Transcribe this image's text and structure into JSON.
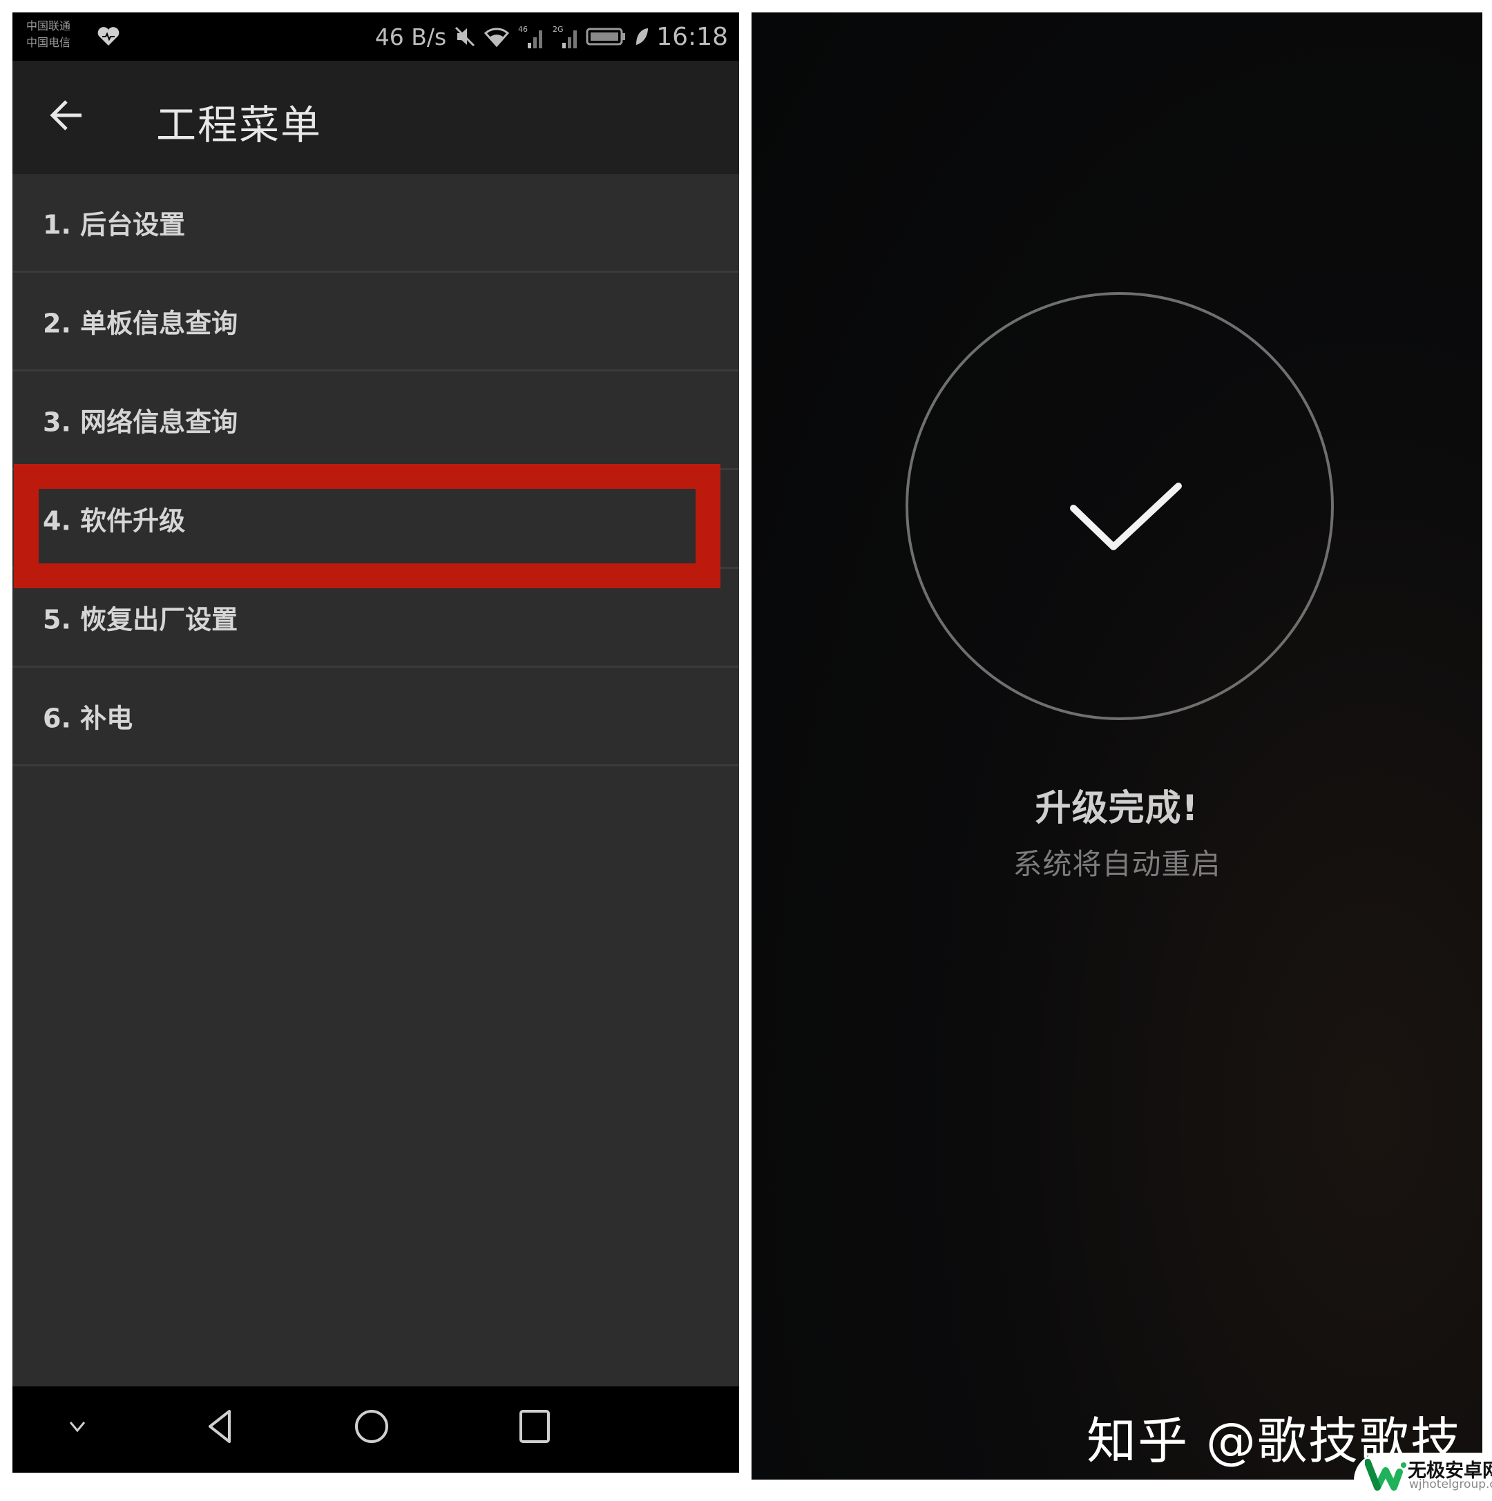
{
  "left_screen": {
    "status_bar": {
      "carriers": [
        "中国联通",
        "中国电信"
      ],
      "net_speed": "46 B/s",
      "signal_1_label": "46",
      "signal_2_label": "2G",
      "battery_level": "",
      "time": "16:18",
      "icons": [
        "heart-icon",
        "mute-icon",
        "wifi-icon",
        "signal-icon",
        "signal-icon",
        "battery-icon",
        "leaf-icon"
      ]
    },
    "app_bar": {
      "back_icon": "arrow-left",
      "title": "工程菜单"
    },
    "menu_items": [
      {
        "label": "1. 后台设置"
      },
      {
        "label": "2. 单板信息查询"
      },
      {
        "label": "3. 网络信息查询"
      },
      {
        "label": "4. 软件升级",
        "highlighted": true
      },
      {
        "label": "5. 恢复出厂设置"
      },
      {
        "label": "6. 补电"
      }
    ],
    "highlight_color": "#bd1a0e",
    "nav_bar": {
      "buttons": [
        "collapse-chevron",
        "back-triangle",
        "home-circle",
        "recents-square"
      ]
    }
  },
  "right_screen": {
    "icon": "checkmark-circle",
    "title": "升级完成!",
    "subtitle": "系统将自动重启",
    "watermark": "知乎 @歌技歌技"
  },
  "site_badge": {
    "name": "无极安卓网",
    "url": "wjhotelgroup.com",
    "logo_color": "#1fb25a"
  }
}
